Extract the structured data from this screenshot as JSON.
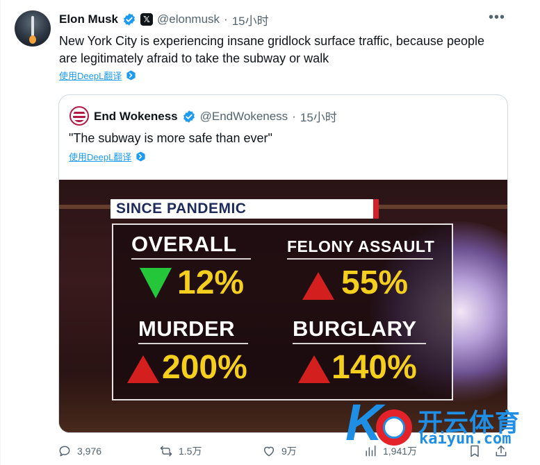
{
  "tweet": {
    "author_name": "Elon Musk",
    "handle": "@elonmusk",
    "separator": "·",
    "time": "15小时",
    "text": "New York City is experiencing insane gridlock surface traffic, because people are legitimately afraid to take the subway or walk",
    "translate_label": "使用DeepL翻译",
    "more_label": "•••"
  },
  "quote": {
    "author_name": "End Wokeness",
    "handle": "@EndWokeness",
    "separator": "·",
    "time": "15小时",
    "text": "\"The subway is more safe than ever\"",
    "translate_label": "使用DeepL翻译",
    "media": {
      "banner": "SINCE PANDEMIC",
      "stats": [
        {
          "label": "OVERALL",
          "value": "12%",
          "direction": "down"
        },
        {
          "label": "FELONY ASSAULT",
          "value": "55%",
          "direction": "up"
        },
        {
          "label": "MURDER",
          "value": "200%",
          "direction": "up"
        },
        {
          "label": "BURGLARY",
          "value": "140%",
          "direction": "up"
        }
      ]
    }
  },
  "actions": {
    "replies": "3,976",
    "reposts": "1.5万",
    "likes": "9万",
    "views": "1,941万"
  },
  "watermark": {
    "letter": "K",
    "brand_cn": "开云体育",
    "brand_en": "kaiyun.com"
  },
  "colors": {
    "link_blue": "#1d9bf0",
    "verified_blue": "#1d9bf0",
    "stat_yellow": "#f5cf1e",
    "down_green": "#26c63a",
    "up_red": "#d41f1f"
  }
}
